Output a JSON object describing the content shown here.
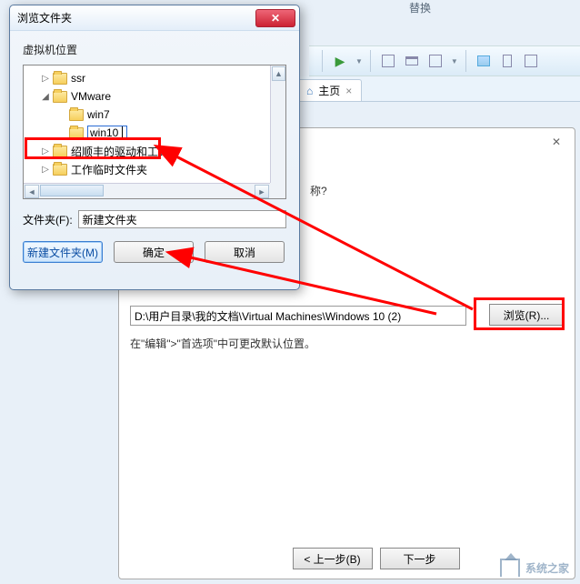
{
  "ribbon": {
    "label_right": "替换"
  },
  "toolbar": {
    "play_glyph": "▶"
  },
  "tabs": {
    "home_label": "主页"
  },
  "dialog": {
    "title": "浏览文件夹",
    "section_label": "虚拟机位置",
    "tree": {
      "items": [
        {
          "label": "ssr",
          "indent": 1,
          "expander": "▷"
        },
        {
          "label": "VMware",
          "indent": 1,
          "expander": "◢"
        },
        {
          "label": "win7",
          "indent": 2,
          "expander": ""
        },
        {
          "label": "win10",
          "indent": 2,
          "expander": "",
          "editing": true
        },
        {
          "label": "绍顺丰的驱动和工具",
          "indent": 1,
          "expander": "▷"
        },
        {
          "label": "工作临时文件夹",
          "indent": 1,
          "expander": "▷"
        }
      ]
    },
    "folder_label": "文件夹(F):",
    "folder_value": "新建文件夹",
    "new_folder_btn": "新建文件夹(M)",
    "ok_btn": "确定",
    "cancel_btn": "取消"
  },
  "wizard": {
    "close_glyph": "✕",
    "truncated_question": "称?",
    "path_value": "D:\\用户目录\\我的文档\\Virtual Machines\\Windows 10 (2)",
    "browse_btn": "浏览(R)...",
    "tip_text": "在\"编辑\">\"首选项\"中可更改默认位置。",
    "back_btn": "< 上一步(B)",
    "next_btn": "下一步"
  },
  "watermark": {
    "text": "系统之家"
  }
}
